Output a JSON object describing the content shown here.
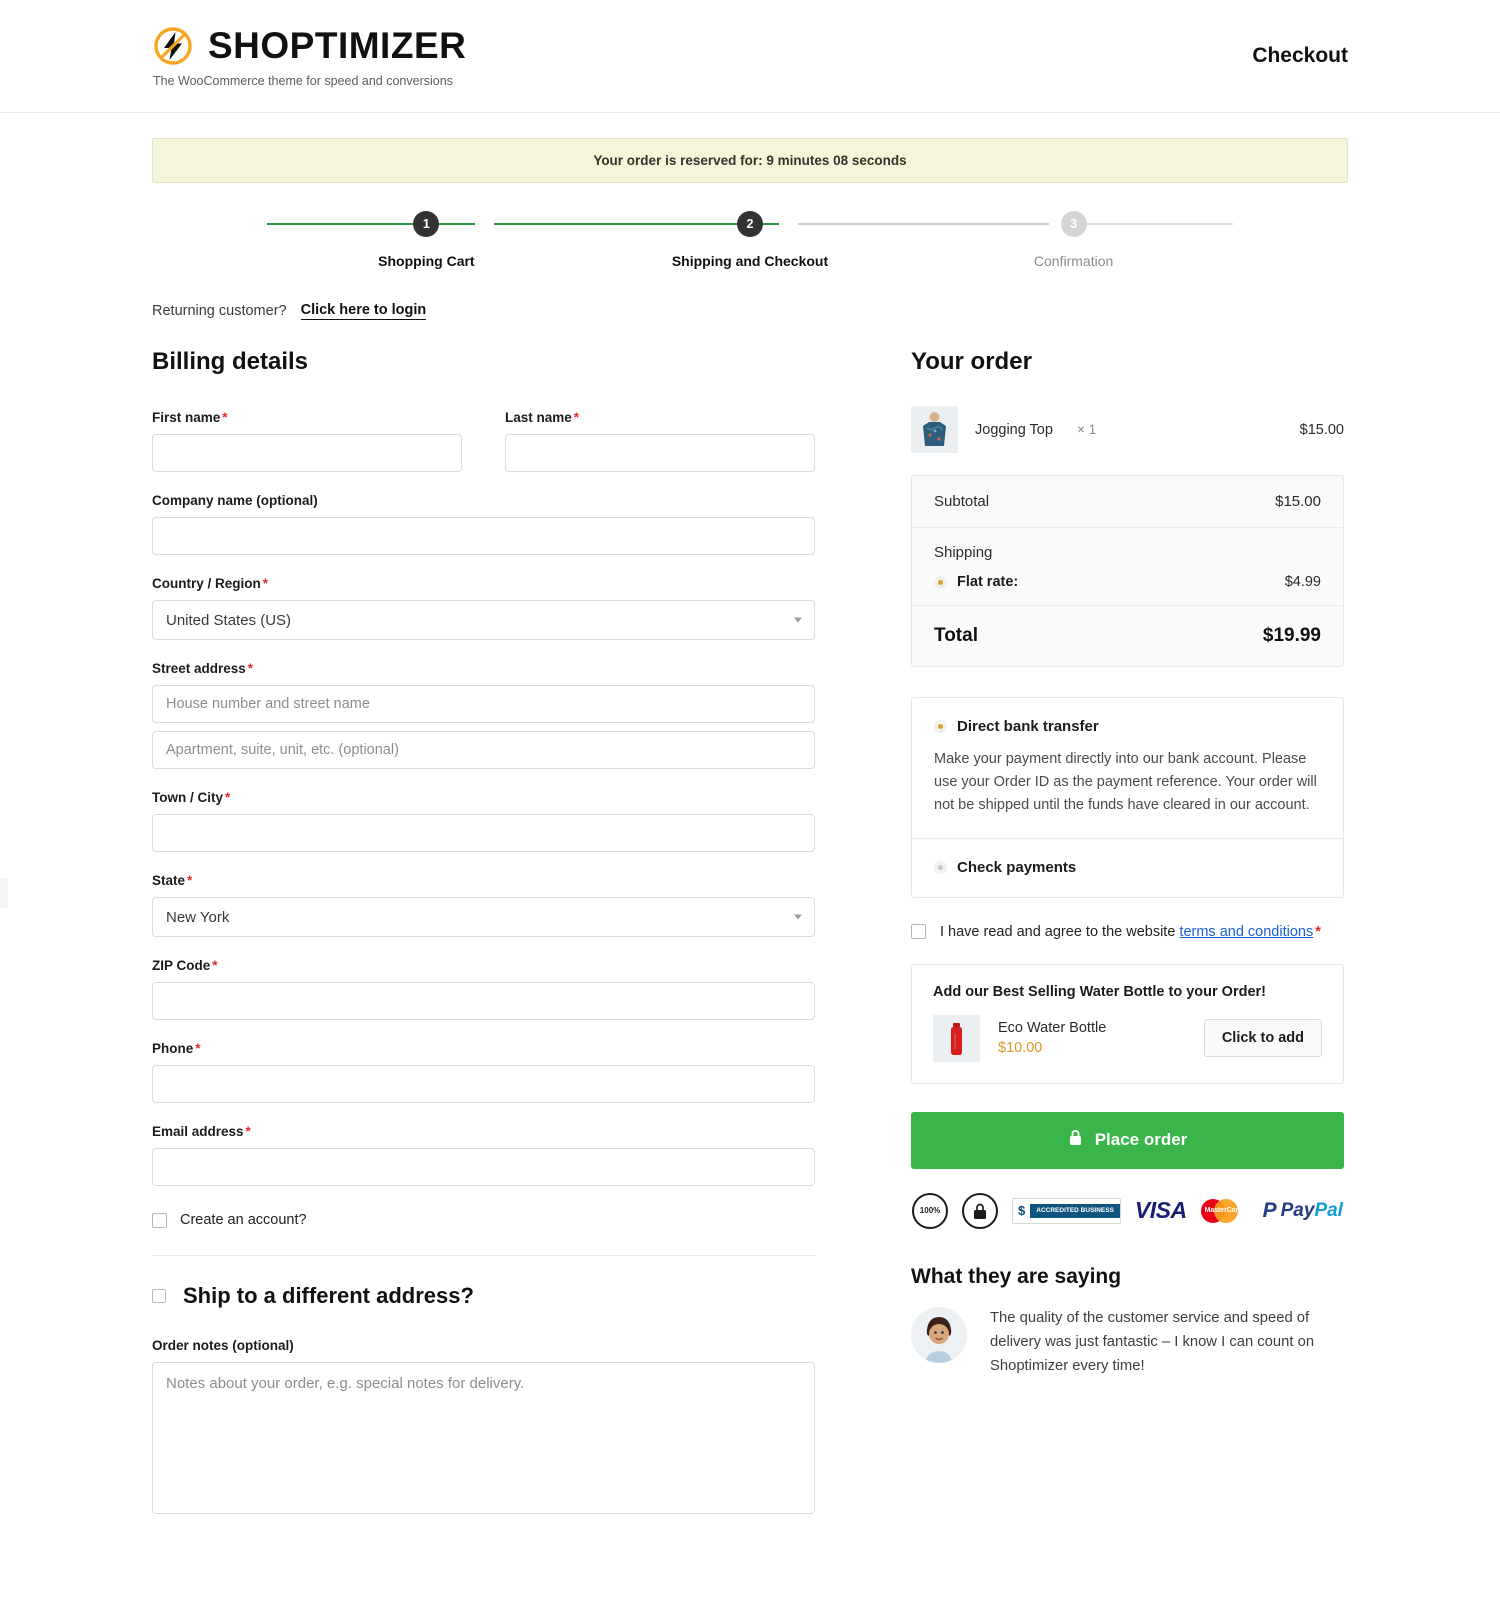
{
  "header": {
    "brand_name": "SHOPTIMIZER",
    "brand_tagline": "The WooCommerce theme for speed and conversions",
    "page_title": "Checkout"
  },
  "reservation": {
    "text": "Your order is reserved for:  9 minutes  08 seconds"
  },
  "steps": [
    {
      "number": "1",
      "label": "Shopping Cart",
      "state": "complete"
    },
    {
      "number": "2",
      "label": "Shipping and Checkout",
      "state": "current"
    },
    {
      "number": "3",
      "label": "Confirmation",
      "state": "upcoming"
    }
  ],
  "returning": {
    "prompt": "Returning customer?",
    "link": "Click here to login"
  },
  "billing": {
    "title": "Billing details",
    "first_name": {
      "label": "First name",
      "required": "*",
      "value": ""
    },
    "last_name": {
      "label": "Last name",
      "required": "*",
      "value": ""
    },
    "company": {
      "label": "Company name (optional)",
      "value": ""
    },
    "country": {
      "label": "Country / Region",
      "required": "*",
      "value": "United States (US)"
    },
    "street": {
      "label": "Street address",
      "required": "*",
      "placeholder_1": "House number and street name",
      "placeholder_2": "Apartment, suite, unit, etc. (optional)"
    },
    "city": {
      "label": "Town / City",
      "required": "*",
      "value": ""
    },
    "state": {
      "label": "State",
      "required": "*",
      "value": "New York"
    },
    "zip": {
      "label": "ZIP Code",
      "required": "*",
      "value": ""
    },
    "phone": {
      "label": "Phone",
      "required": "*",
      "value": ""
    },
    "email": {
      "label": "Email address",
      "required": "*",
      "value": ""
    },
    "create_account": "Create an account?",
    "ship_different": "Ship to a different address?",
    "notes_label": "Order notes (optional)",
    "notes_placeholder": "Notes about your order, e.g. special notes for delivery."
  },
  "order": {
    "title": "Your order",
    "item": {
      "name": "Jogging Top",
      "qty": "× 1",
      "price": "$15.00"
    },
    "subtotal_label": "Subtotal",
    "subtotal_value": "$15.00",
    "shipping_label": "Shipping",
    "shipping_option": "Flat rate:",
    "shipping_value": "$4.99",
    "total_label": "Total",
    "total_value": "$19.99"
  },
  "payment": {
    "methods": [
      {
        "label": "Direct bank transfer",
        "selected": true,
        "description": "Make your payment directly into our bank account. Please use your Order ID as the payment reference. Your order will not be shipped until the funds have cleared in our account."
      },
      {
        "label": "Check payments",
        "selected": false,
        "description": ""
      }
    ]
  },
  "terms": {
    "text_before": "I have read and agree to the website",
    "link": "terms and conditions",
    "required": "*"
  },
  "upsell": {
    "title": "Add our Best Selling Water Bottle to your Order!",
    "product_name": "Eco Water Bottle",
    "product_price": "$10.00",
    "button": "Click to add"
  },
  "place_order": {
    "label": "Place order",
    "icon": "lock-icon"
  },
  "trust_badges": [
    {
      "name": "satisfaction-guarantee-badge",
      "text": "100%"
    },
    {
      "name": "secure-badge",
      "text": "SECURE"
    },
    {
      "name": "bbb-accredited-badge",
      "text_a": "$",
      "text_b": "ACCREDITED BUSINESS"
    },
    {
      "name": "visa-badge",
      "text": "VISA"
    },
    {
      "name": "mastercard-badge",
      "text": "MasterCard"
    },
    {
      "name": "paypal-badge",
      "text_a": "Pay",
      "text_b": "Pal"
    }
  ],
  "testimonial": {
    "heading": "What they are saying",
    "quote": "The quality of the customer service and speed of delivery was just fantastic – I know I can count on Shoptimizer every time!"
  },
  "colors": {
    "accent_green": "#39b54a",
    "progress_green": "#27963f",
    "banner_bg": "#f5f5dc",
    "required_red": "#e02b2b",
    "link_blue": "#1a5fd6",
    "price_gold": "#d79a24",
    "logo_orange": "#f5a623"
  }
}
